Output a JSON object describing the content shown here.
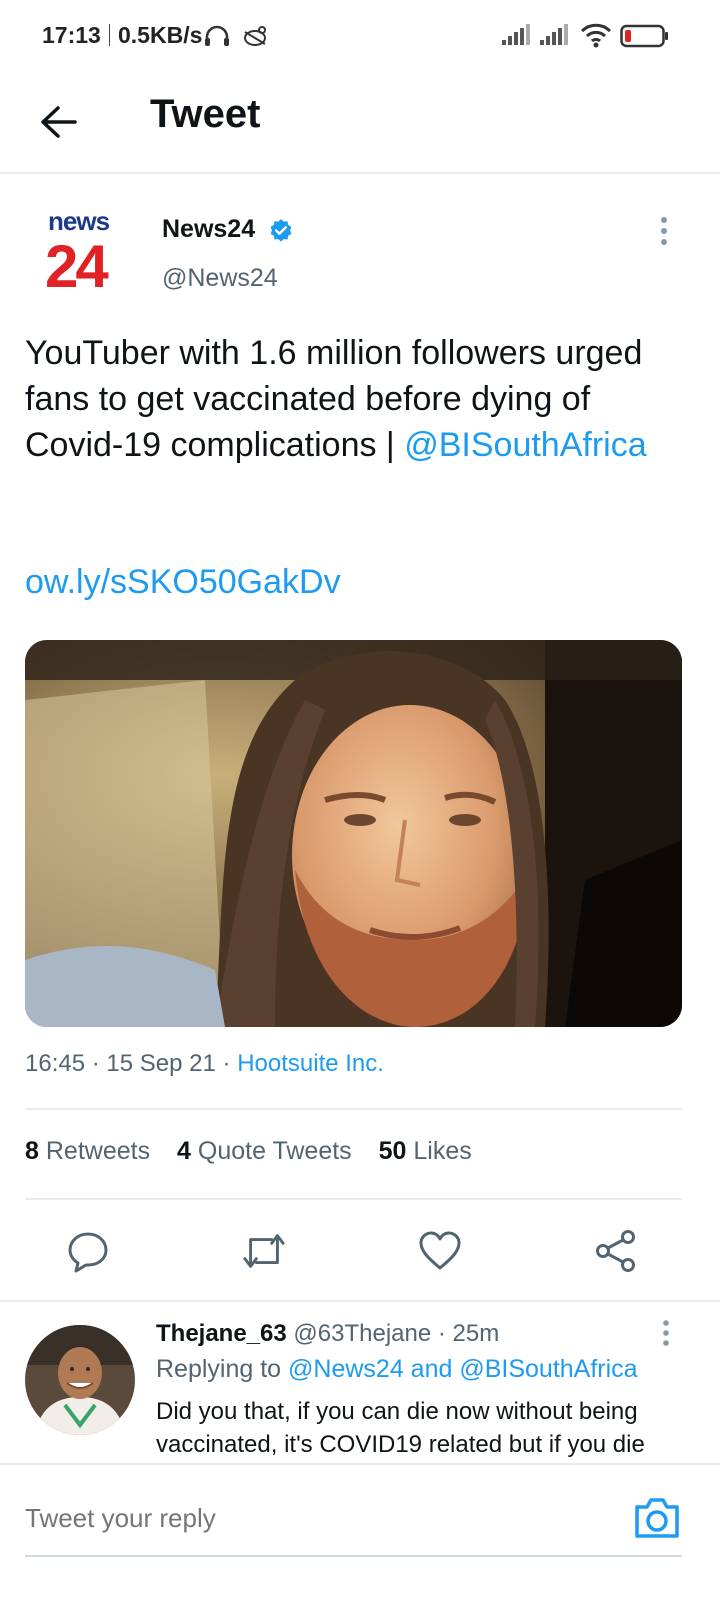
{
  "status_bar": {
    "time": "17:13",
    "speed": "0.5KB/s",
    "icons": [
      "headphones-icon",
      "bug-icon",
      "signal-icon",
      "signal-icon",
      "wifi-icon",
      "battery-icon"
    ]
  },
  "header": {
    "title": "Tweet"
  },
  "author": {
    "logo_line1": "news",
    "logo_line2": "24",
    "name": "News24",
    "handle": "@News24",
    "verified": true
  },
  "tweet": {
    "text": "YouTuber with 1.6 million followers urged fans to get vaccinated before dying of Covid-19 complications | ",
    "mention": "@BISouthAfrica",
    "url": "ow.ly/sSKO50GakDv",
    "time": "16:45",
    "date": "15 Sep 21",
    "source": "Hootsuite Inc."
  },
  "stats": {
    "retweets_count": "8",
    "retweets_label": "Retweets",
    "quotes_count": "4",
    "quotes_label": "Quote Tweets",
    "likes_count": "50",
    "likes_label": "Likes"
  },
  "reply": {
    "name": "Thejane_63",
    "handle": "@63Thejane",
    "time": "25m",
    "replying_prefix": "Replying to",
    "replying_targets": "@News24 and @BISouthAfrica",
    "text": "Did you that, if you can die now without being vaccinated, it's COVID19 related but if you die"
  },
  "composer": {
    "placeholder": "Tweet your reply"
  },
  "colors": {
    "accent": "#1d9bf0",
    "text": "#0f1419",
    "muted": "#536471",
    "brand_red": "#e02224",
    "brand_blue": "#1d3a8a"
  }
}
